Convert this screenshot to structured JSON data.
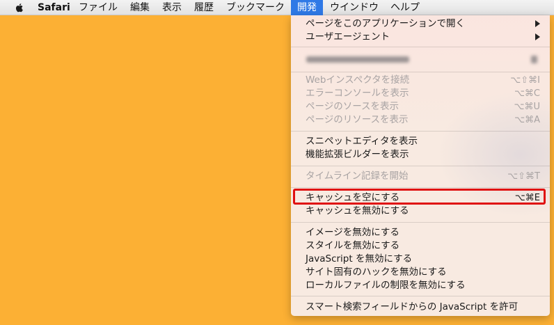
{
  "menubar": {
    "apple_icon": "apple-logo-icon",
    "items": [
      {
        "label": "Safari"
      },
      {
        "label": "ファイル"
      },
      {
        "label": "編集"
      },
      {
        "label": "表示"
      },
      {
        "label": "履歴"
      },
      {
        "label": "ブックマーク"
      },
      {
        "label": "開発"
      },
      {
        "label": "ウインドウ"
      },
      {
        "label": "ヘルプ"
      }
    ]
  },
  "menu": {
    "items": [
      {
        "label": "ページをこのアプリケーションで開く",
        "submenu": true
      },
      {
        "label": "ユーザエージェント",
        "submenu": true
      },
      {
        "label": "Webインスペクタを接続",
        "shortcut": "⌥⇧⌘I",
        "disabled": true
      },
      {
        "label": "エラーコンソールを表示",
        "shortcut": "⌥⌘C",
        "disabled": true
      },
      {
        "label": "ページのソースを表示",
        "shortcut": "⌥⌘U",
        "disabled": true
      },
      {
        "label": "ページのリソースを表示",
        "shortcut": "⌥⌘A",
        "disabled": true
      },
      {
        "label": "スニペットエディタを表示"
      },
      {
        "label": "機能拡張ビルダーを表示"
      },
      {
        "label": "タイムライン記録を開始",
        "shortcut": "⌥⇧⌘T",
        "disabled": true
      },
      {
        "label": "キャッシュを空にする",
        "shortcut": "⌥⌘E"
      },
      {
        "label": "キャッシュを無効にする"
      },
      {
        "label": "イメージを無効にする"
      },
      {
        "label": "スタイルを無効にする"
      },
      {
        "label": "JavaScript を無効にする"
      },
      {
        "label": "サイト固有のハックを無効にする"
      },
      {
        "label": "ローカルファイルの制限を無効にする"
      },
      {
        "label": "スマート検索フィールドからの JavaScript を許可"
      }
    ]
  },
  "colors": {
    "desktop": "#fcb034",
    "menubar_active": "#2f79e6",
    "highlight": "#e01010",
    "disabled_text": "#a8a3a3"
  }
}
